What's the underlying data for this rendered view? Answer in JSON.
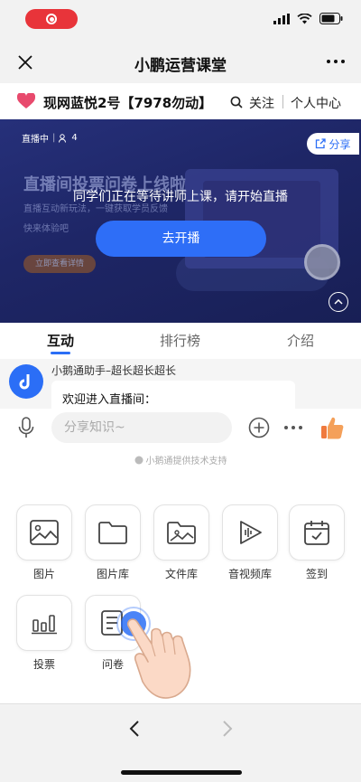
{
  "nav": {
    "title": "小鹏运营课堂"
  },
  "info": {
    "room_name": "现网蓝悦2号【7978勿动】",
    "follow_label": "关注",
    "center_label": "个人中心"
  },
  "banner": {
    "live_status": "直播中",
    "viewer_count": "4",
    "share_label": "分享",
    "bg_headline": "直播间投票问卷上线啦",
    "bg_sub1": "直播互动新玩法，一键获取学员反馈",
    "bg_sub2": "快来体验吧",
    "bg_button": "立即查看详情",
    "waiting_text": "同学们正在等待讲师上课，请开始直播",
    "start_button": "去开播"
  },
  "tabs": [
    {
      "label": "互动",
      "active": true
    },
    {
      "label": "排行榜",
      "active": false
    },
    {
      "label": "介绍",
      "active": false
    }
  ],
  "chat": {
    "sender": "小鹅通助手–超长超长超长",
    "message": "欢迎进入直播间："
  },
  "input": {
    "placeholder": "分享知识~",
    "support_text": "小鹅通提供技术支持"
  },
  "tools": [
    {
      "label": "图片",
      "icon": "image-icon"
    },
    {
      "label": "图片库",
      "icon": "folder-icon"
    },
    {
      "label": "文件库",
      "icon": "file-library-icon"
    },
    {
      "label": "音视频库",
      "icon": "media-library-icon"
    },
    {
      "label": "签到",
      "icon": "checkin-icon"
    },
    {
      "label": "投票",
      "icon": "vote-icon"
    },
    {
      "label": "问卷",
      "icon": "questionnaire-icon"
    }
  ],
  "colors": {
    "accent": "#2e6ef7",
    "banner_bg": "#1e2666",
    "record": "#e8343a"
  }
}
